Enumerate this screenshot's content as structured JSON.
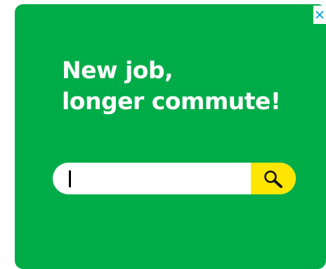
{
  "ad": {
    "headline_line1": "New job,",
    "headline_line2": "longer commute!",
    "search": {
      "placeholder": "",
      "value": "",
      "button_icon": "magnifier-icon"
    },
    "close_icon": "close-icon",
    "colors": {
      "background": "#00ac48",
      "text": "#ffffff",
      "search_button": "#ffe600",
      "close_icon": "#00a0e0"
    }
  }
}
